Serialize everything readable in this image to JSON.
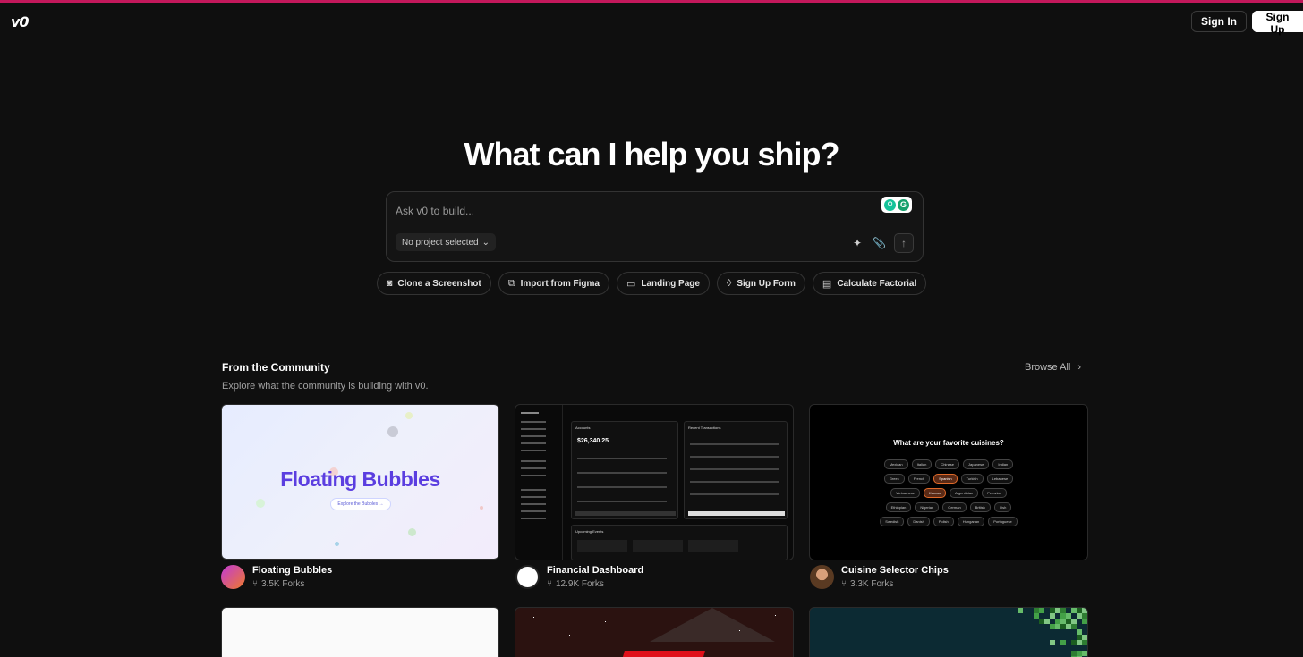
{
  "brand": {
    "logo": "v0"
  },
  "auth": {
    "signin_label": "Sign In",
    "signup_label": "Sign Up"
  },
  "hero": {
    "title": "What can I help you ship?"
  },
  "prompt": {
    "placeholder": "Ask v0 to build...",
    "project_selector": "No project selected"
  },
  "chips": [
    {
      "label": "Clone a Screenshot",
      "icon": "camera-icon"
    },
    {
      "label": "Import from Figma",
      "icon": "figma-icon"
    },
    {
      "label": "Landing Page",
      "icon": "layout-icon"
    },
    {
      "label": "Sign Up Form",
      "icon": "droplet-icon"
    },
    {
      "label": "Calculate Factorial",
      "icon": "calculator-icon"
    }
  ],
  "community": {
    "title": "From the Community",
    "subtitle": "Explore what the community is building with v0.",
    "browse_label": "Browse All",
    "cards": [
      {
        "name": "Floating Bubbles",
        "forks": "3.5K Forks",
        "preview_title": "Floating Bubbles",
        "preview_button": "Explore the Bubbles  →"
      },
      {
        "name": "Financial Dashboard",
        "forks": "12.9K Forks",
        "preview_heading": "Accounts",
        "preview_amount": "$26,340.25",
        "preview_panel": "Recent Transactions",
        "preview_footer": "Upcoming Events"
      },
      {
        "name": "Cuisine Selector Chips",
        "forks": "3.3K Forks",
        "preview_question": "What are your favorite cuisines?"
      }
    ]
  },
  "cuisines": [
    [
      "Mexican",
      "Italian",
      "Chinese",
      "Japanese",
      "Indian"
    ],
    [
      "Greek",
      "French",
      "Spanish",
      "Turkish",
      "Lebanese"
    ],
    [
      "Vietnamese",
      "Korean",
      "Argentinian",
      "Peruvian"
    ],
    [
      "Ethiopian",
      "Nigerian",
      "German",
      "British",
      "Irish"
    ],
    [
      "Swedish",
      "Danish",
      "Polish",
      "Hungarian",
      "Portuguese"
    ]
  ],
  "cuisines_selected": [
    "Spanish",
    "Korean"
  ],
  "colors": {
    "accent_line": "#c2185b",
    "background": "#0f0f0f",
    "bubbles_title": "#5b3ee0"
  }
}
